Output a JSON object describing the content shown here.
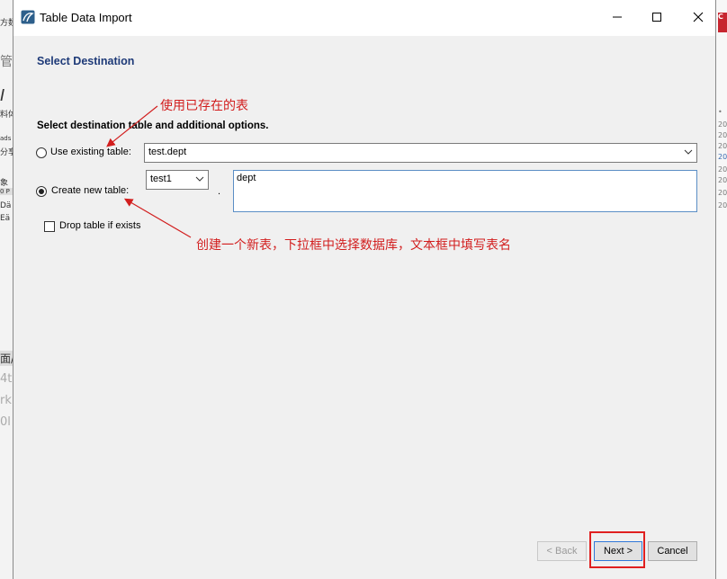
{
  "window": {
    "title": "Table Data Import",
    "controls": {
      "minimize": "minimize",
      "maximize": "maximize",
      "close": "close"
    }
  },
  "page": {
    "section_title": "Select Destination",
    "instruction": "Select destination table and additional options."
  },
  "options": {
    "use_existing": {
      "label": "Use existing table:",
      "selected": false,
      "value": "test.dept"
    },
    "create_new": {
      "label": "Create new table:",
      "selected": true,
      "schema_value": "test1",
      "separator": ".",
      "table_name": "dept"
    },
    "drop_if_exists": {
      "label": "Drop table if exists",
      "checked": false
    }
  },
  "buttons": {
    "back": "< Back",
    "next": "Next >",
    "cancel": "Cancel"
  },
  "annotations": {
    "use_existing_note": "使用已存在的表",
    "create_new_note": "创建一个新表，下拉框中选择数据库，文本框中填写表名",
    "color": "#d21e1e"
  },
  "background": {
    "left_fragments": [
      "方数",
      "管",
      "I",
      "料体",
      "ads",
      "分享",
      "象",
      "0 P",
      "Dä",
      "Eä",
      "面/",
      "4t",
      "rk",
      "0l"
    ],
    "right_badge": "C",
    "right_fragments": [
      "•",
      "20",
      "20",
      "20",
      "20",
      "20",
      "20",
      "20",
      "20"
    ]
  }
}
